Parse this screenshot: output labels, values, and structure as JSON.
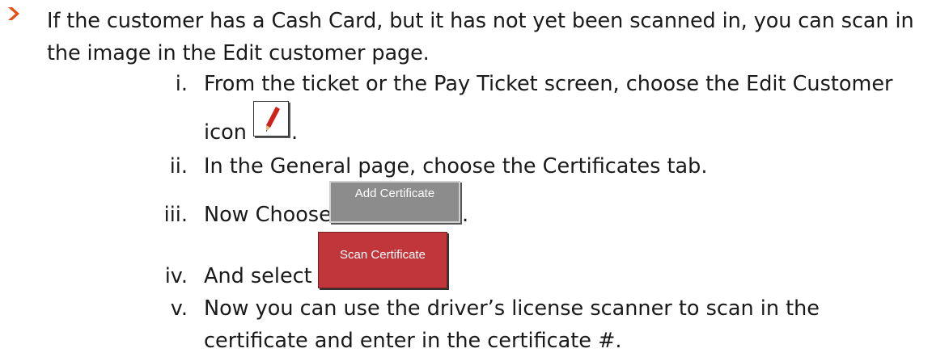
{
  "bullet": {
    "icon": "chevron-right-icon",
    "color": "#e84e0f",
    "text": "If the customer has a Cash Card, but it has not yet been scanned in, you can scan in the image in the Edit customer page."
  },
  "steps": [
    {
      "numeral": "i.",
      "text": "From the ticket or the Pay Ticket screen, choose the Edit Customer",
      "continuation": "icon",
      "after": "."
    },
    {
      "numeral": "ii.",
      "text": "In the General page, choose the Certificates tab."
    },
    {
      "numeral": "iii.",
      "text": "Now Choose",
      "after": "."
    },
    {
      "numeral": "iv.",
      "text": "And select"
    },
    {
      "numeral": "v.",
      "text": "Now you can use the driver’s license scanner to scan in the certificate and enter in the certificate #."
    }
  ],
  "buttons": {
    "edit_customer_icon": "pencil-icon",
    "add_certificate": "Add Certificate",
    "add_certificate_color": "#8c8c8c",
    "scan_certificate": "Scan Certificate",
    "scan_certificate_color": "#c0363a"
  }
}
